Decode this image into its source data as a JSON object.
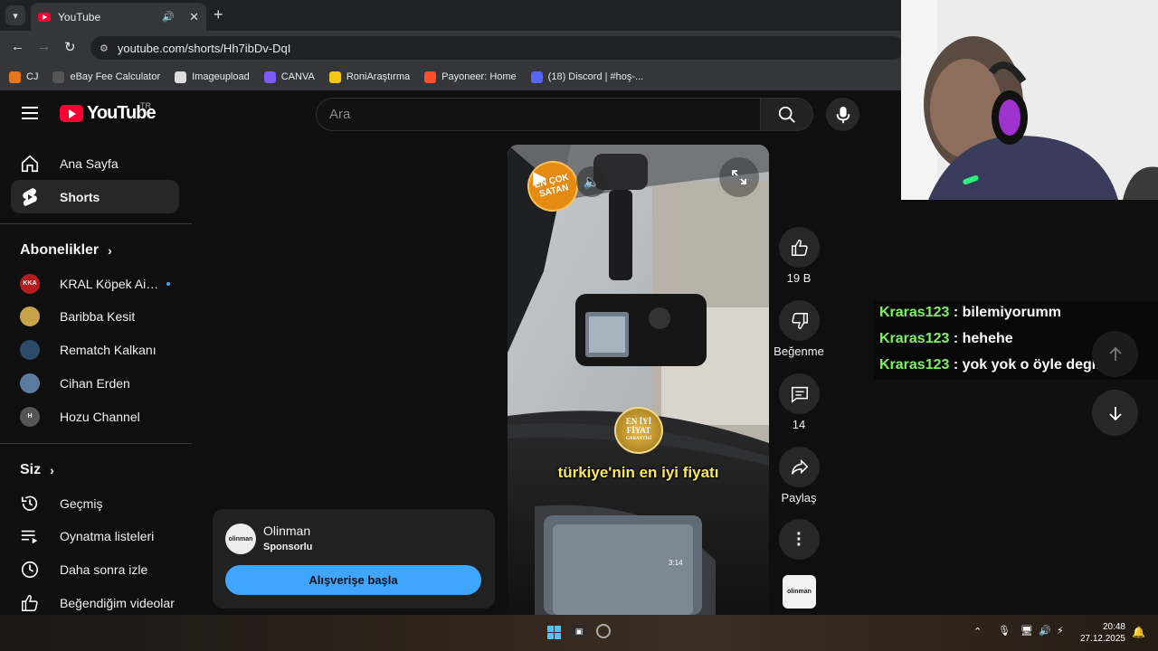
{
  "browser": {
    "tab_title": "YouTube",
    "url": "youtube.com/shorts/Hh7ibDv-DqI",
    "bookmarks": [
      {
        "label": "CJ",
        "color": "#e8741c"
      },
      {
        "label": "eBay Fee Calculator",
        "color": "#555555"
      },
      {
        "label": "Imageupload",
        "color": "#dddddd"
      },
      {
        "label": "CANVA",
        "color": "#7d5cf5"
      },
      {
        "label": "RoniAraştırma",
        "color": "#f5c518"
      },
      {
        "label": "Payoneer: Home",
        "color": "#ff4f2a"
      },
      {
        "label": "(18) Discord | #hoş-...",
        "color": "#5865f2"
      }
    ]
  },
  "masthead": {
    "logo_text": "YouTube",
    "country": "TR",
    "search_placeholder": "Ara"
  },
  "sidebar": {
    "main": [
      {
        "label": "Ana Sayfa",
        "icon": "home-icon"
      },
      {
        "label": "Shorts",
        "icon": "shorts-icon",
        "active": true
      }
    ],
    "subs_heading": "Abonelikler",
    "subscriptions": [
      {
        "label": "KRAL Köpek Aile...",
        "avatar_text": "KKA",
        "avatar_color": "#b71c1c",
        "live": true
      },
      {
        "label": "Baribba Kesit",
        "avatar_text": "",
        "avatar_color": "#c9a34a"
      },
      {
        "label": "Rematch Kalkanı",
        "avatar_text": "",
        "avatar_color": "#2d4a66"
      },
      {
        "label": "Cihan Erden",
        "avatar_text": "",
        "avatar_color": "#5a7aa0"
      },
      {
        "label": "Hozu Channel",
        "avatar_text": "H",
        "avatar_color": "#555555"
      }
    ],
    "you_heading": "Siz",
    "you_items": [
      {
        "label": "Geçmiş",
        "icon": "history-icon"
      },
      {
        "label": "Oynatma listeleri",
        "icon": "playlists-icon"
      },
      {
        "label": "Daha sonra izle",
        "icon": "watch-later-icon"
      },
      {
        "label": "Beğendiğim videolar",
        "icon": "liked-icon"
      }
    ]
  },
  "short": {
    "badge_line1": "EN ÇOK",
    "badge_line2": "SATAN",
    "seal_line1": "EN İYİ",
    "seal_line2": "FİYAT",
    "seal_line3": "GARANTİSİ",
    "caption": "türkiye'nin en iyi fiyatı",
    "screen_time": "3:14"
  },
  "ad": {
    "channel": "Olinman",
    "logo_text": "olinman",
    "sponsored": "Sponsorlu",
    "cta": "Alışverişe başla"
  },
  "actions": {
    "likes": "19 B",
    "dislike_label": "Beğenme",
    "comments": "14",
    "share_label": "Paylaş",
    "channel_thumb_text": "olinman"
  },
  "chat": [
    {
      "user": "Kraras123",
      "message": "bilemiyorumm"
    },
    {
      "user": "Kraras123",
      "message": "hehehe"
    },
    {
      "user": "Kraras123",
      "message": "yok yok o öyle degil"
    }
  ],
  "taskbar": {
    "time": "20:48",
    "date": "27.12.2025"
  }
}
